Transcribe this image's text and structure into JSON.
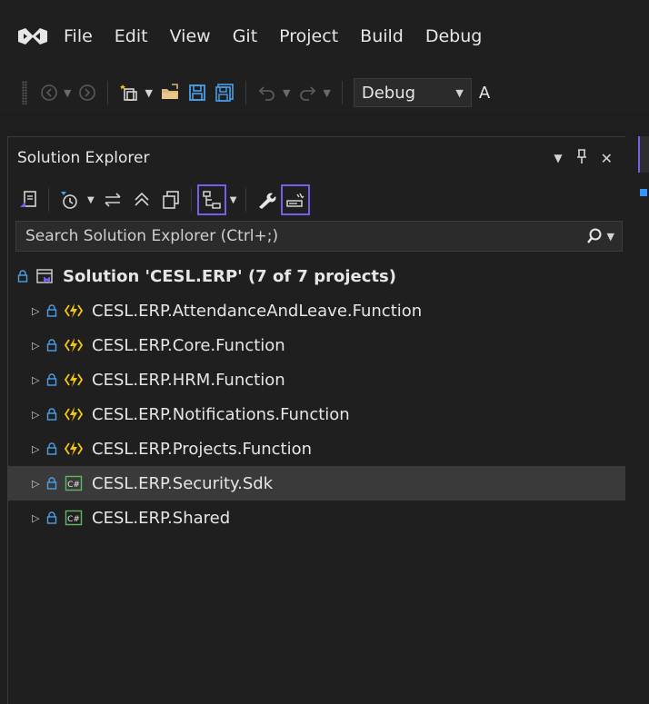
{
  "menu": {
    "items": [
      "File",
      "Edit",
      "View",
      "Git",
      "Project",
      "Build",
      "Debug"
    ]
  },
  "toolbar": {
    "configuration": "Debug",
    "platform_partial": "A"
  },
  "solution_explorer": {
    "title": "Solution Explorer",
    "pin_glyph": "࿿",
    "search_placeholder": "Search Solution Explorer (Ctrl+;)",
    "solution_label": "Solution 'CESL.ERP' (7 of 7 projects)",
    "projects": [
      {
        "name": "CESL.ERP.AttendanceAndLeave.Function",
        "icon": "azure-function-icon",
        "selected": false
      },
      {
        "name": "CESL.ERP.Core.Function",
        "icon": "azure-function-icon",
        "selected": false
      },
      {
        "name": "CESL.ERP.HRM.Function",
        "icon": "azure-function-icon",
        "selected": false
      },
      {
        "name": "CESL.ERP.Notifications.Function",
        "icon": "azure-function-icon",
        "selected": false
      },
      {
        "name": "CESL.ERP.Projects.Function",
        "icon": "azure-function-icon",
        "selected": false
      },
      {
        "name": "CESL.ERP.Security.Sdk",
        "icon": "csharp-project-icon",
        "selected": true
      },
      {
        "name": "CESL.ERP.Shared",
        "icon": "csharp-project-icon",
        "selected": false
      }
    ]
  },
  "colors": {
    "accent": "#7160e8",
    "function_yellow": "#f2c811",
    "csharp_green": "#5fb85f"
  }
}
